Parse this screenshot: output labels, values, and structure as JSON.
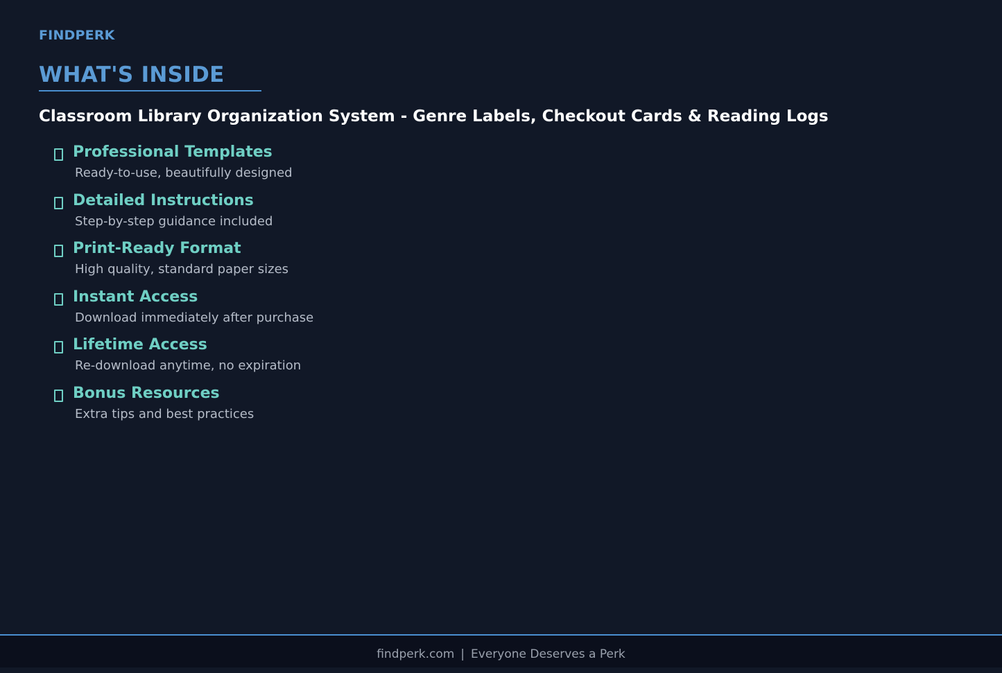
{
  "brand": "FINDPERK",
  "section_title": "WHAT'S INSIDE",
  "product_title": "Classroom Library Organization System - Genre Labels, Checkout Cards & Reading Logs",
  "features": [
    {
      "icon": "checkbox-icon",
      "title": "Professional Templates",
      "description": "Ready-to-use, beautifully designed"
    },
    {
      "icon": "checkbox-icon",
      "title": "Detailed Instructions",
      "description": "Step-by-step guidance included"
    },
    {
      "icon": "checkbox-icon",
      "title": "Print-Ready Format",
      "description": "High quality, standard paper sizes"
    },
    {
      "icon": "checkbox-icon",
      "title": "Instant Access",
      "description": "Download immediately after purchase"
    },
    {
      "icon": "checkbox-icon",
      "title": "Lifetime Access",
      "description": "Re-download anytime, no expiration"
    },
    {
      "icon": "checkbox-icon",
      "title": "Bonus Resources",
      "description": "Extra tips and best practices"
    }
  ],
  "footer": {
    "site": "findperk.com",
    "separator": "|",
    "tagline": "Everyone Deserves a Perk"
  },
  "colors": {
    "background": "#111827",
    "accent": "#5b9bd5",
    "feature_title": "#6fcfc4",
    "footer_background": "#0b0f1c"
  }
}
